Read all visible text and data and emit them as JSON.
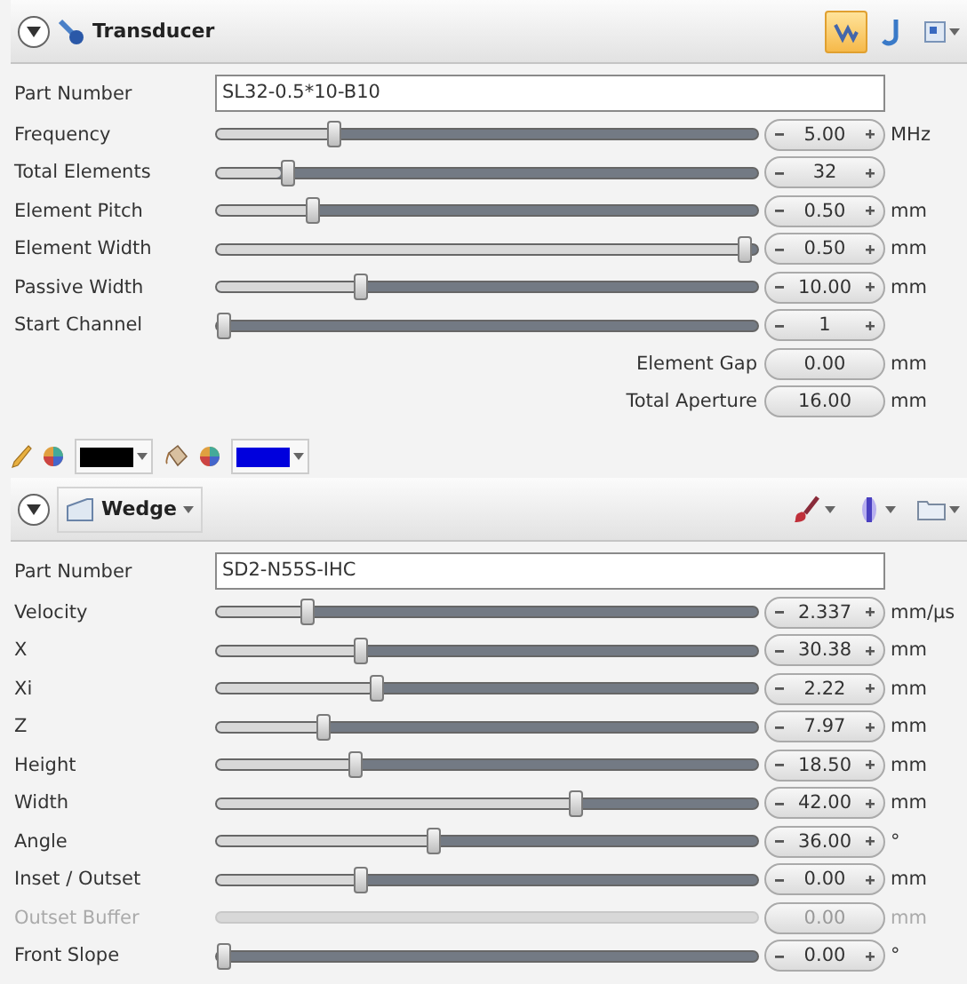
{
  "transducer": {
    "title": "Transducer",
    "expanded": true,
    "tools": [
      {
        "kind": "probe-view",
        "selected": true
      },
      {
        "kind": "probe-side",
        "selected": false
      },
      {
        "kind": "menu",
        "selected": false
      }
    ],
    "rows": [
      {
        "kind": "text",
        "label": "Part Number",
        "value": "SL32-0.5*10-B10"
      },
      {
        "kind": "slider",
        "label": "Frequency",
        "level": 0.21,
        "value": "5.00",
        "unit": "MHz",
        "disabled": false
      },
      {
        "kind": "slider",
        "label": "Total Elements",
        "level": 0.12,
        "value": "32",
        "disabled": false
      },
      {
        "kind": "slider",
        "label": "Element Pitch",
        "level": 0.17,
        "value": "0.50",
        "unit": "mm",
        "disabled": false
      },
      {
        "kind": "slider",
        "label": "Element Width",
        "level": 0.99,
        "value": "0.50",
        "unit": "mm",
        "disabled": false
      },
      {
        "kind": "slider",
        "label": "Passive Width",
        "level": 0.26,
        "value": "10.00",
        "unit": "mm",
        "disabled": false
      },
      {
        "kind": "slider",
        "label": "Start Channel",
        "level": 0,
        "value": "1",
        "disabled": false
      },
      {
        "kind": "readout",
        "label": "Element Gap",
        "value": "0.00",
        "unit": "mm"
      },
      {
        "kind": "readout",
        "label": "Total Aperture",
        "value": "16.00",
        "unit": "mm"
      }
    ]
  },
  "style_toolbar": [
    {
      "kind": "line",
      "color": "#000000"
    },
    {
      "kind": "fill",
      "color": "#0000dd"
    }
  ],
  "wedge": {
    "title": "Wedge",
    "expanded": true,
    "tools": [
      {
        "kind": "brush",
        "selected": false
      },
      {
        "kind": "beam",
        "selected": false
      },
      {
        "kind": "folder",
        "selected": false
      }
    ],
    "rows": [
      {
        "kind": "text",
        "label": "Part Number",
        "value": "SD2-N55S-IHC"
      },
      {
        "kind": "slider",
        "label": "Velocity",
        "level": 0.16,
        "value": "2.337",
        "unit": "mm/µs",
        "disabled": false
      },
      {
        "kind": "slider",
        "label": "X",
        "level": 0.26,
        "value": "30.38",
        "unit": "mm",
        "disabled": false
      },
      {
        "kind": "slider",
        "label": "Xi",
        "level": 0.29,
        "value": "2.22",
        "unit": "mm",
        "disabled": false
      },
      {
        "kind": "slider",
        "label": "Z",
        "level": 0.19,
        "value": "7.97",
        "unit": "mm",
        "disabled": false
      },
      {
        "kind": "slider",
        "label": "Height",
        "level": 0.25,
        "value": "18.50",
        "unit": "mm",
        "disabled": false
      },
      {
        "kind": "slider",
        "label": "Width",
        "level": 0.67,
        "value": "42.00",
        "unit": "mm",
        "disabled": false
      },
      {
        "kind": "slider",
        "label": "Angle",
        "level": 0.4,
        "value": "36.00",
        "unit": "°",
        "disabled": false
      },
      {
        "kind": "slider",
        "label": "Inset / Outset",
        "level": 0.26,
        "value": "0.00",
        "unit": "mm",
        "disabled": false
      },
      {
        "kind": "slider",
        "label": "Outset Buffer",
        "value": "0.00",
        "unit": "mm",
        "disabled": true
      },
      {
        "kind": "slider",
        "label": "Front Slope",
        "level": 0,
        "value": "0.00",
        "unit": "°",
        "disabled": false
      }
    ]
  }
}
